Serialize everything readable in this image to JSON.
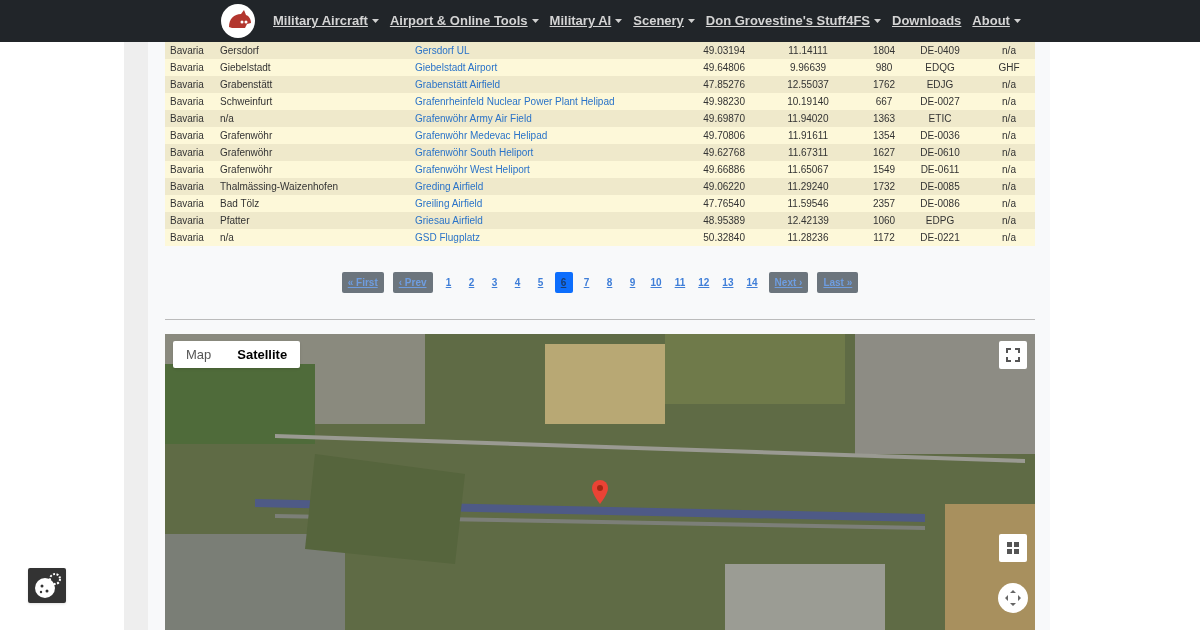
{
  "navbar": {
    "items": [
      {
        "label": "Military Aircraft",
        "dropdown": true
      },
      {
        "label": "Airport & Online Tools",
        "dropdown": true
      },
      {
        "label": "Military AI",
        "dropdown": true
      },
      {
        "label": "Scenery",
        "dropdown": true
      },
      {
        "label": "Don Grovestine's Stuff4FS",
        "dropdown": true
      },
      {
        "label": "Downloads",
        "dropdown": false
      },
      {
        "label": "About",
        "dropdown": true
      }
    ]
  },
  "table": {
    "rows": [
      [
        "Bavaria",
        "Gersdorf",
        "Gersdorf UL",
        "49.03194",
        "11.14111",
        "1804",
        "DE-0409",
        "n/a"
      ],
      [
        "Bavaria",
        "Giebelstadt",
        "Giebelstadt Airport",
        "49.64806",
        "9.96639",
        "980",
        "EDQG",
        "GHF"
      ],
      [
        "Bavaria",
        "Grabenstätt",
        "Grabenstätt Airfield",
        "47.85276",
        "12.55037",
        "1762",
        "EDJG",
        "n/a"
      ],
      [
        "Bavaria",
        "Schweinfurt",
        "Grafenrheinfeld Nuclear Power Plant Helipad",
        "49.98230",
        "10.19140",
        "667",
        "DE-0027",
        "n/a"
      ],
      [
        "Bavaria",
        "n/a",
        "Grafenwöhr Army Air Field",
        "49.69870",
        "11.94020",
        "1363",
        "ETIC",
        "n/a"
      ],
      [
        "Bavaria",
        "Grafenwöhr",
        "Grafenwöhr Medevac Helipad",
        "49.70806",
        "11.91611",
        "1354",
        "DE-0036",
        "n/a"
      ],
      [
        "Bavaria",
        "Grafenwöhr",
        "Grafenwöhr South Heliport",
        "49.62768",
        "11.67311",
        "1627",
        "DE-0610",
        "n/a"
      ],
      [
        "Bavaria",
        "Grafenwöhr",
        "Grafenwöhr West Heliport",
        "49.66886",
        "11.65067",
        "1549",
        "DE-0611",
        "n/a"
      ],
      [
        "Bavaria",
        "Thalmässing-Waizenhofen",
        "Greding Airfield",
        "49.06220",
        "11.29240",
        "1732",
        "DE-0085",
        "n/a"
      ],
      [
        "Bavaria",
        "Bad Tölz",
        "Greiling Airfield",
        "47.76540",
        "11.59546",
        "2357",
        "DE-0086",
        "n/a"
      ],
      [
        "Bavaria",
        "Pfatter",
        "Griesau Airfield",
        "48.95389",
        "12.42139",
        "1060",
        "EDPG",
        "n/a"
      ],
      [
        "Bavaria",
        "n/a",
        "GSD Flugplatz",
        "50.32840",
        "11.28236",
        "1172",
        "DE-0221",
        "n/a"
      ]
    ]
  },
  "pagination": {
    "first": "« First",
    "prev": "‹ Prev",
    "next": "Next ›",
    "last": "Last »",
    "pages": [
      {
        "label": "1",
        "selected": false
      },
      {
        "label": "2",
        "selected": false
      },
      {
        "label": "3",
        "selected": false
      },
      {
        "label": "4",
        "selected": false
      },
      {
        "label": "5",
        "selected": false
      },
      {
        "label": "6",
        "selected": true
      },
      {
        "label": "7",
        "selected": false
      },
      {
        "label": "8",
        "selected": false
      },
      {
        "label": "9",
        "selected": false
      },
      {
        "label": "10",
        "selected": false
      },
      {
        "label": "11",
        "selected": false
      },
      {
        "label": "12",
        "selected": false
      },
      {
        "label": "13",
        "selected": false
      },
      {
        "label": "14",
        "selected": false
      }
    ]
  },
  "map": {
    "kind": "picture",
    "type_buttons": [
      {
        "label": "Map",
        "selected": false
      },
      {
        "label": "Satellite",
        "selected": true
      }
    ]
  }
}
